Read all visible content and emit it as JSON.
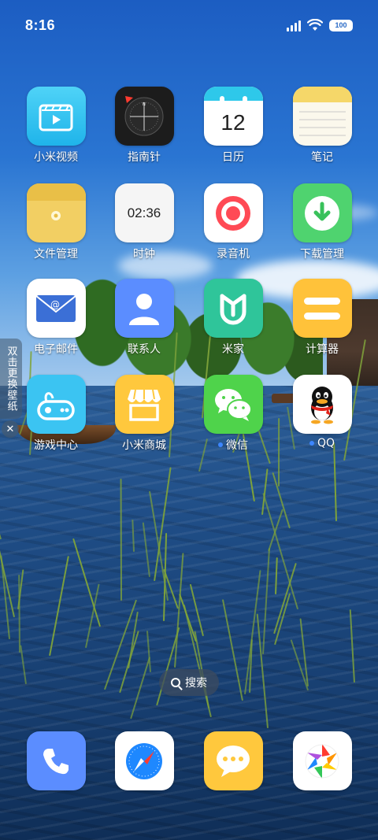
{
  "status_bar": {
    "time": "8:16",
    "battery": "100"
  },
  "apps": [
    {
      "label": "小米视频",
      "icon": "video-player-icon",
      "color": "#2fc1f0"
    },
    {
      "label": "指南针",
      "icon": "compass-icon",
      "color": "#1c1c1c"
    },
    {
      "label": "日历",
      "icon": "calendar-icon",
      "color": "#ffffff",
      "day": "12"
    },
    {
      "label": "笔记",
      "icon": "notes-icon",
      "color": "#f7f3e3"
    },
    {
      "label": "文件管理",
      "icon": "folder-icon",
      "color": "#f2cf63"
    },
    {
      "label": "时钟",
      "icon": "clock-icon",
      "color": "#f5f5f5",
      "clock_text": "02:36"
    },
    {
      "label": "录音机",
      "icon": "recorder-icon",
      "color": "#ffffff"
    },
    {
      "label": "下载管理",
      "icon": "download-icon",
      "color": "#4fd36f"
    },
    {
      "label": "电子邮件",
      "icon": "email-icon",
      "color": "#ffffff"
    },
    {
      "label": "联系人",
      "icon": "contacts-icon",
      "color": "#5b8dff"
    },
    {
      "label": "米家",
      "icon": "mijia-icon",
      "color": "#2fc59a"
    },
    {
      "label": "计算器",
      "icon": "calculator-icon",
      "color": "#ffc23a"
    },
    {
      "label": "游戏中心",
      "icon": "game-center-icon",
      "color": "#3bc4f2"
    },
    {
      "label": "小米商城",
      "icon": "mi-store-icon",
      "color": "#ffc83d"
    },
    {
      "label": "微信",
      "icon": "wechat-icon",
      "color": "#4fd34b",
      "new_dot": true
    },
    {
      "label": "QQ",
      "icon": "qq-icon",
      "color": "#ffffff",
      "new_dot": true
    }
  ],
  "side_hint": {
    "text": "双击更换壁纸",
    "close_glyph": "✕"
  },
  "search": {
    "label": "搜索"
  },
  "dock": [
    {
      "icon": "phone-icon",
      "color": "#5b8dff"
    },
    {
      "icon": "browser-icon",
      "color": "#ffffff"
    },
    {
      "icon": "messages-icon",
      "color": "#ffc83d"
    },
    {
      "icon": "gallery-icon",
      "color": "#ffffff"
    }
  ]
}
